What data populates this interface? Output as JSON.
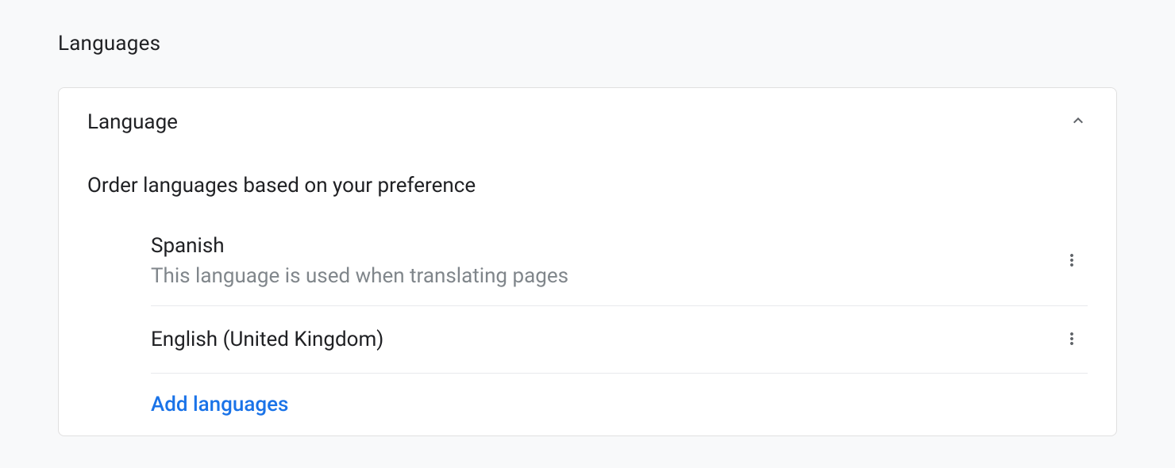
{
  "section": {
    "title": "Languages"
  },
  "card": {
    "header": "Language",
    "subtitle": "Order languages based on your preference"
  },
  "languages": [
    {
      "name": "Spanish",
      "description": "This language is used when translating pages"
    },
    {
      "name": "English (United Kingdom)",
      "description": ""
    }
  ],
  "actions": {
    "addLanguages": "Add languages"
  }
}
